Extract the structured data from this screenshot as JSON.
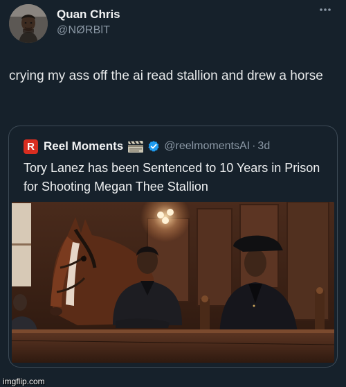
{
  "author": {
    "name": "Quan Chris",
    "handle": "@NØRBlT"
  },
  "tweet": {
    "text": "crying my ass off the ai read stallion and drew a horse"
  },
  "quote": {
    "logo_letter": "R",
    "name": "Reel Moments",
    "handle": "@reelmomentsAI",
    "separator": "·",
    "time": "3d",
    "text": "Tory Lanez has been Sentenced to 10 Years in Prison for Shooting Megan Thee Stallion"
  },
  "icons": {
    "more": "more-dots-icon",
    "verified": "verified-badge-icon",
    "clapper": "clapperboard-emoji-icon"
  },
  "colors": {
    "background": "#16212b",
    "verified": "#1d9bf0",
    "logo": "#d92d20"
  },
  "watermark": "imgflip.com"
}
